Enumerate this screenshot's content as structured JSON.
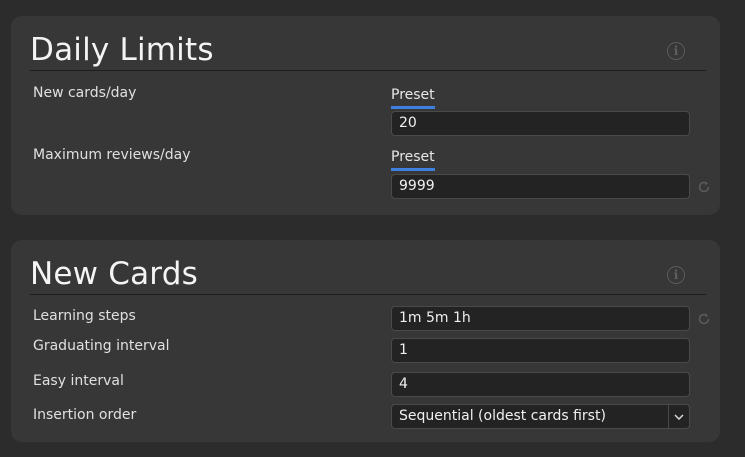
{
  "daily_limits": {
    "title": "Daily Limits",
    "info_icon_glyph": "i",
    "rows": [
      {
        "label": "New cards/day",
        "preset_label": "Preset",
        "value": "20"
      },
      {
        "label": "Maximum reviews/day",
        "preset_label": "Preset",
        "value": "9999"
      }
    ]
  },
  "new_cards": {
    "title": "New Cards",
    "info_icon_glyph": "i",
    "learning_steps": {
      "label": "Learning steps",
      "value": "1m 5m 1h"
    },
    "graduating_interval": {
      "label": "Graduating interval",
      "value": "1"
    },
    "easy_interval": {
      "label": "Easy interval",
      "value": "4"
    },
    "insertion_order": {
      "label": "Insertion order",
      "selected": "Sequential (oldest cards first)"
    }
  },
  "colors": {
    "background": "#2c2c2c",
    "card": "#373737",
    "input": "#232323",
    "accent": "#3f7fe0"
  },
  "icons": [
    "info-icon",
    "reset-icon",
    "chevron-down-icon"
  ]
}
